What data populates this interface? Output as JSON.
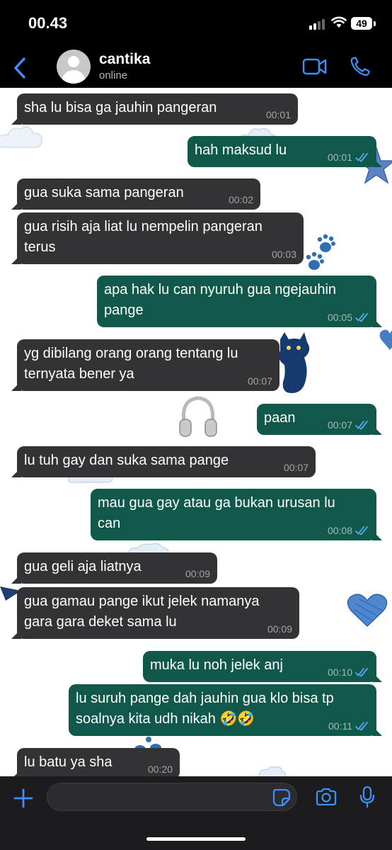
{
  "status_bar": {
    "time": "00.43",
    "battery": "49"
  },
  "header": {
    "contact_name": "cantika",
    "contact_status": "online"
  },
  "messages": [
    {
      "dir": "in",
      "lines": [
        "sha lu bisa ga jauhin pangeran"
      ],
      "time": "00:01"
    },
    {
      "dir": "out",
      "lines": [
        "hah maksud lu"
      ],
      "time": "00:01"
    },
    {
      "dir": "in",
      "lines": [
        "gua suka sama pangeran"
      ],
      "time": "00:02"
    },
    {
      "dir": "in",
      "lines": [
        "gua risih aja liat lu nempelin pangeran",
        "terus"
      ],
      "time": "00:03"
    },
    {
      "dir": "out",
      "lines": [
        "apa hak lu can nyuruh gua ngejauhin",
        "pange"
      ],
      "time": "00:05"
    },
    {
      "dir": "in",
      "lines": [
        "yg dibilang orang orang tentang lu",
        "ternyata bener ya"
      ],
      "time": "00:07"
    },
    {
      "dir": "out",
      "lines": [
        "paan"
      ],
      "time": "00:07"
    },
    {
      "dir": "in",
      "lines": [
        "lu tuh gay dan suka sama pange"
      ],
      "time": "00:07"
    },
    {
      "dir": "out",
      "lines": [
        "mau gua gay atau ga bukan urusan lu",
        "can"
      ],
      "time": "00:08"
    },
    {
      "dir": "in",
      "lines": [
        "gua geli aja liatnya"
      ],
      "time": "00:09"
    },
    {
      "dir": "in",
      "lines": [
        "gua gamau pange ikut jelek namanya",
        "gara gara deket sama lu"
      ],
      "time": "00:09"
    },
    {
      "dir": "out",
      "lines": [
        "muka lu noh jelek anj"
      ],
      "time": "00:10"
    },
    {
      "dir": "out",
      "lines": [
        "lu suruh pange dah jauhin gua klo bisa tp",
        "soalnya kita udh nikah 🤣🤣"
      ],
      "time": "00:11"
    },
    {
      "dir": "in",
      "lines": [
        "lu batu ya sha"
      ],
      "time": "00:20"
    }
  ],
  "input": {
    "placeholder": ""
  },
  "icons": {
    "back": "chevron-left-icon",
    "video": "video-camera-icon",
    "call": "phone-icon",
    "plus": "plus-icon",
    "sticker": "sticker-icon",
    "camera": "camera-icon",
    "mic": "microphone-icon",
    "read": "double-check-icon"
  },
  "colors": {
    "accent": "#3d8ef7",
    "incoming_bubble": "#333335",
    "outgoing_bubble": "#10584a",
    "read_check": "#53a9f5"
  }
}
